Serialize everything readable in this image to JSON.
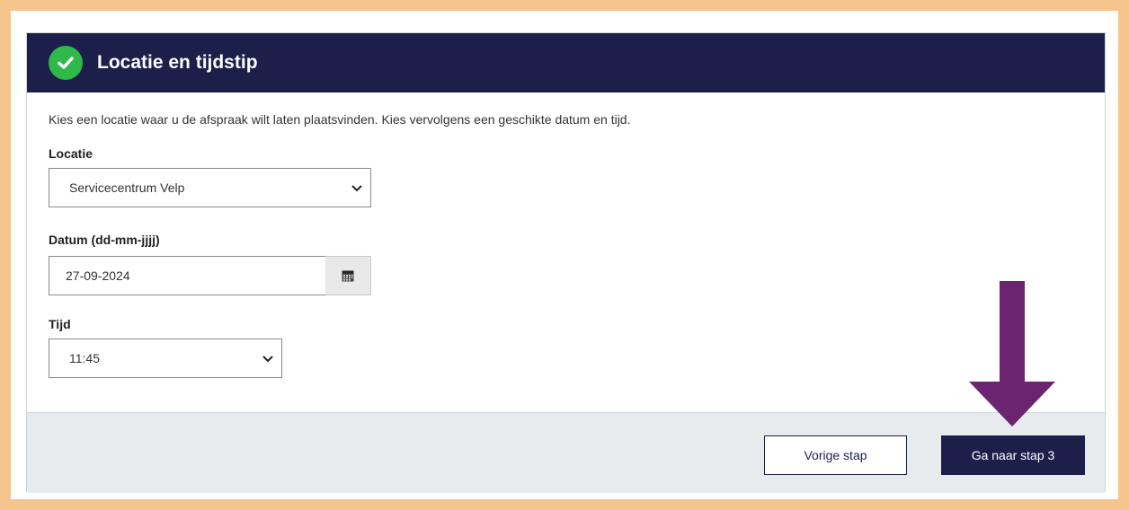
{
  "section": {
    "title": "Locatie en tijdstip",
    "intro": "Kies een locatie waar u de afspraak wilt laten plaatsvinden. Kies vervolgens een geschikte datum en tijd."
  },
  "location": {
    "label": "Locatie",
    "selected": "Servicecentrum Velp"
  },
  "date": {
    "label": "Datum (dd-mm-jjjj)",
    "value": "27-09-2024"
  },
  "time": {
    "label": "Tijd",
    "selected": "11:45"
  },
  "footer": {
    "previous_label": "Vorige stap",
    "next_label": "Ga naar stap 3"
  },
  "icons": {
    "header": "check-circle-icon",
    "date": "calendar-icon",
    "annotation": "arrow-down-icon"
  },
  "colors": {
    "header_bg": "#1b1f4a",
    "check_green": "#2fb94a",
    "annotation_arrow": "#6b2470",
    "frame_border": "#f6c58e"
  }
}
